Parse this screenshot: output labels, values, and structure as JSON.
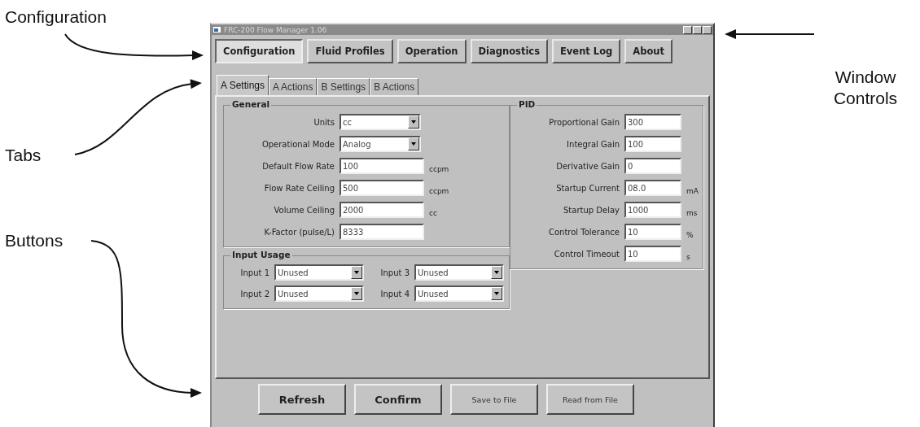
{
  "annotations": [
    {
      "label": "Configuration"
    },
    {
      "label": "Tabs"
    },
    {
      "label": "Buttons"
    },
    {
      "label": "Window Controls"
    }
  ],
  "window": {
    "title": "FRC-200 Flow Manager 1.06"
  },
  "main_tabs": [
    {
      "label": "Configuration",
      "selected": true
    },
    {
      "label": "Fluid Profiles",
      "selected": false
    },
    {
      "label": "Operation",
      "selected": false
    },
    {
      "label": "Diagnostics",
      "selected": false
    },
    {
      "label": "Event Log",
      "selected": false
    },
    {
      "label": "About",
      "selected": false
    }
  ],
  "sub_tabs": [
    {
      "label": "A Settings",
      "selected": true
    },
    {
      "label": "A Actions",
      "selected": false
    },
    {
      "label": "B Settings",
      "selected": false
    },
    {
      "label": "B Actions",
      "selected": false
    }
  ],
  "general": {
    "title": "General",
    "fields": [
      {
        "label": "Units",
        "kind": "dropdown",
        "value": "cc"
      },
      {
        "label": "Operational Mode",
        "kind": "dropdown",
        "value": "Analog"
      },
      {
        "label": "Default Flow Rate",
        "kind": "text",
        "value": "100",
        "unit": "ccpm"
      },
      {
        "label": "Flow Rate Ceiling",
        "kind": "text",
        "value": "500",
        "unit": "ccpm"
      },
      {
        "label": "Volume Ceiling",
        "kind": "text",
        "value": "2000",
        "unit": "cc"
      },
      {
        "label": "K-Factor (pulse/L)",
        "kind": "text",
        "value": "8333"
      }
    ]
  },
  "pid": {
    "title": "PID",
    "fields": [
      {
        "label": "Proportional Gain",
        "kind": "text",
        "value": "300"
      },
      {
        "label": "Integral Gain",
        "kind": "text",
        "value": "100"
      },
      {
        "label": "Derivative Gain",
        "kind": "text",
        "value": "0"
      },
      {
        "label": "Startup Current",
        "kind": "text",
        "value": "08.0",
        "unit": "mA"
      },
      {
        "label": "Startup Delay",
        "kind": "text",
        "value": "1000",
        "unit": "ms"
      },
      {
        "label": "Control Tolerance",
        "kind": "text",
        "value": "10",
        "unit": "%"
      },
      {
        "label": "Control Timeout",
        "kind": "text",
        "value": "10",
        "unit": "s"
      }
    ]
  },
  "input_usage": {
    "title": "Input Usage",
    "inputs": [
      {
        "label": "Input 1",
        "value": "Unused"
      },
      {
        "label": "Input 3",
        "value": "Unused"
      },
      {
        "label": "Input 2",
        "value": "Unused"
      },
      {
        "label": "Input 4",
        "value": "Unused"
      }
    ]
  },
  "buttons": [
    {
      "label": "Refresh",
      "kind": "primary"
    },
    {
      "label": "Confirm",
      "kind": "primary"
    },
    {
      "label": "Save to File",
      "kind": "secondary"
    },
    {
      "label": "Read from File",
      "kind": "secondary"
    }
  ]
}
